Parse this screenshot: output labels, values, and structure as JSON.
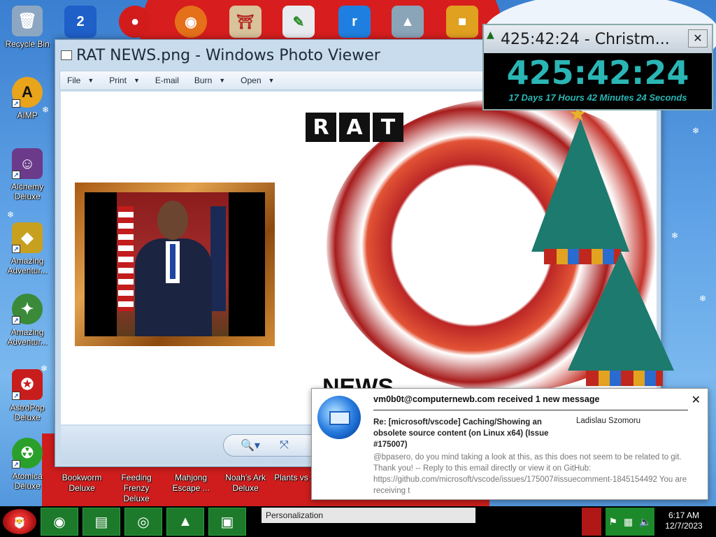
{
  "desktop": {
    "left_icons": [
      {
        "label": "Recycle Bin",
        "icon": "recycle-bin-icon",
        "color": "#8da7c2"
      },
      {
        "label": "AIMP",
        "icon": "aimp-icon",
        "color": "#e8a41a"
      },
      {
        "label": "Alchemy Deluxe",
        "icon": "alchemy-icon",
        "color": "#6b3a8a"
      },
      {
        "label": "Amazing Adventur...",
        "icon": "amazing-adventures-icon",
        "color": "#c8a020"
      },
      {
        "label": "Amazing Adventur...",
        "icon": "amazing-adventures-2-icon",
        "color": "#3a8a3a"
      },
      {
        "label": "AstroPop Deluxe",
        "icon": "astropop-icon",
        "color": "#c81d1d"
      },
      {
        "label": "Atomica Deluxe",
        "icon": "atomica-icon",
        "color": "#2aa02a"
      }
    ],
    "bottom_labels": [
      {
        "label": "Bookworm Deluxe"
      },
      {
        "label": "Feeding Frenzy Deluxe"
      },
      {
        "label": "Mahjong Escape ..."
      },
      {
        "label": "Noah's Ark Deluxe"
      },
      {
        "label": "Plants vs Zombies"
      }
    ]
  },
  "photo_viewer": {
    "title": "RAT NEWS.png - Windows Photo Viewer",
    "menu": [
      "File",
      "Print",
      "E-mail",
      "Burn",
      "Open"
    ],
    "image": {
      "logo_letters": [
        "R",
        "A",
        "T"
      ],
      "news_word": "NEWS"
    }
  },
  "countdown": {
    "title": "425:42:24 - Christm...",
    "time": "425:42:24",
    "detail": "17 Days 17 Hours 42 Minutes 24 Seconds"
  },
  "notification": {
    "header": "vm0b0t@computernewb.com received 1 new message",
    "subject": "Re: [microsoft/vscode] Caching/Showing an obsolete source content (on Linux x64) (Issue #175007)",
    "from": "Ladislau Szomoru",
    "body": "@bpasero, do you mind taking a look at this, as this does not seem to be related to git. Thank you! -- Reply to this email directly or view it on GitHub: https://github.com/microsoft/vscode/issues/175007#issuecomment-1845154492 You are receiving t"
  },
  "taskbar": {
    "active_label": "Personalization",
    "time": "6:17 AM",
    "date": "12/7/2023"
  }
}
